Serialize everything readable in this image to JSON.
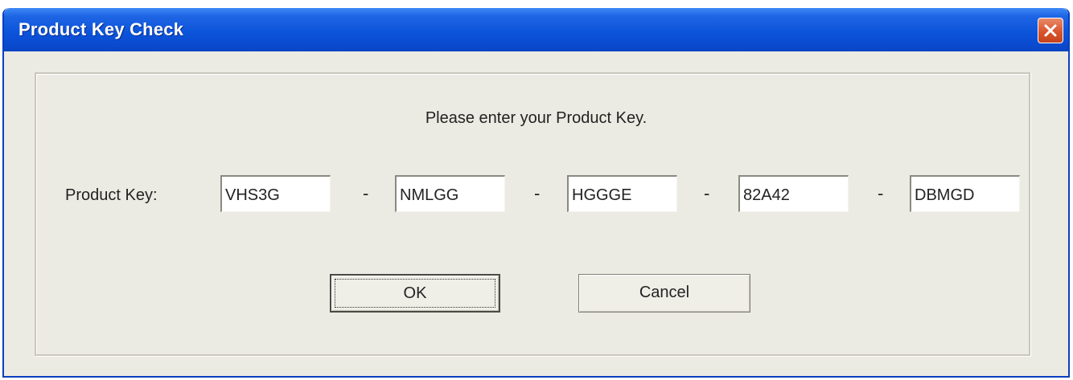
{
  "window": {
    "title": "Product Key Check"
  },
  "dialog": {
    "prompt": "Please enter your Product Key.",
    "key_label": "Product Key:",
    "separator": "-",
    "key_segments": [
      "VHS3G",
      "NMLGG",
      "HGGGE",
      "82A42",
      "DBMGD"
    ],
    "ok_label": "OK",
    "cancel_label": "Cancel"
  },
  "colors": {
    "titlebar": "#0c54da",
    "close_button": "#d9542c",
    "window_body": "#ecebe3"
  },
  "icons": {
    "close": "close-icon"
  }
}
